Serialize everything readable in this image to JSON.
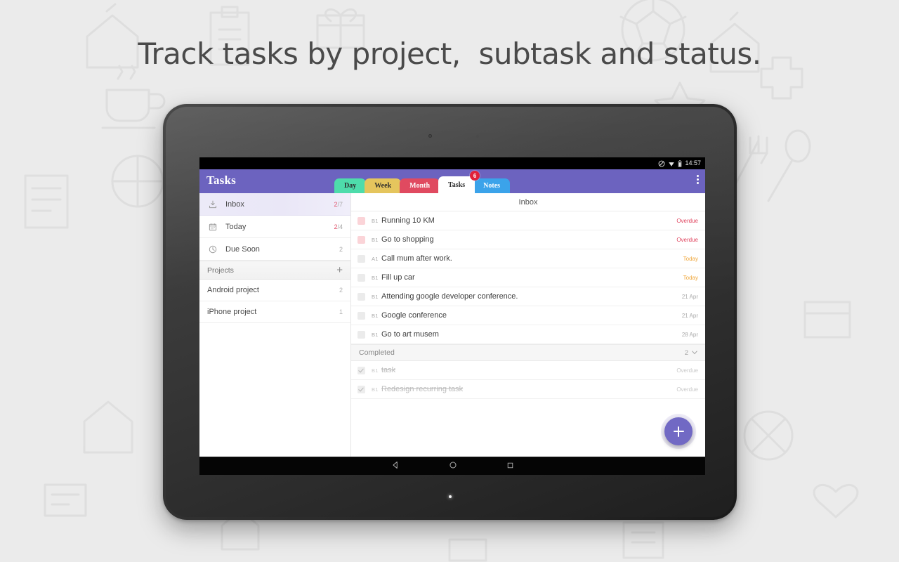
{
  "headline": "Track tasks by project,  subtask and status.",
  "statusbar": {
    "clock": "14:57",
    "icons": [
      "do-not-disturb-icon",
      "wifi-icon",
      "battery-icon"
    ]
  },
  "appbar": {
    "title": "Tasks",
    "overflow_label": "overflow-menu",
    "tabs": [
      {
        "label": "Day",
        "color": "#4edcab",
        "active": false
      },
      {
        "label": "Week",
        "color": "#e5c55d",
        "active": false
      },
      {
        "label": "Month",
        "color": "#e04a60",
        "active": false
      },
      {
        "label": "Tasks",
        "color": "#ffffff",
        "active": true
      },
      {
        "label": "Notes",
        "color": "#3ba3ea",
        "active": false
      }
    ],
    "badge": "6"
  },
  "sidebar": {
    "items": [
      {
        "label": "Inbox",
        "icon": "inbox-icon",
        "count_done": "2",
        "count_sep": "/7",
        "selected": true
      },
      {
        "label": "Today",
        "icon": "calendar-icon",
        "count_done": "2",
        "count_sep": "/4",
        "selected": false
      },
      {
        "label": "Due Soon",
        "icon": "clock-icon",
        "count_done": "",
        "count_sep": "2",
        "selected": false
      }
    ],
    "projects_header": {
      "label": "Projects",
      "add_label": "+"
    },
    "projects": [
      {
        "label": "Android project",
        "count": "2"
      },
      {
        "label": "iPhone project",
        "count": "1"
      }
    ]
  },
  "taskpane": {
    "title": "Inbox",
    "tasks": [
      {
        "name": "Running 10 KM",
        "priority": "B1",
        "due": "Overdue",
        "due_kind": "due-overdue",
        "checkbox": "overdue",
        "done": false
      },
      {
        "name": "Go to shopping",
        "priority": "B1",
        "due": "Overdue",
        "due_kind": "due-overdue",
        "checkbox": "overdue",
        "done": false
      },
      {
        "name": "Call mum after work.",
        "priority": "A1",
        "due": "Today",
        "due_kind": "due-today",
        "checkbox": "normal",
        "done": false
      },
      {
        "name": "Fill up car",
        "priority": "B1",
        "due": "Today",
        "due_kind": "due-today",
        "checkbox": "normal",
        "done": false
      },
      {
        "name": "Attending google developer conference.",
        "priority": "B1",
        "due": "21 Apr",
        "due_kind": "due-date",
        "checkbox": "normal",
        "done": false
      },
      {
        "name": "Google conference",
        "priority": "B1",
        "due": "21 Apr",
        "due_kind": "due-date",
        "checkbox": "normal",
        "done": false
      },
      {
        "name": "Go to art musem",
        "priority": "B1",
        "due": "28 Apr",
        "due_kind": "due-date",
        "checkbox": "normal",
        "done": false
      }
    ],
    "completed_header": {
      "label": "Completed",
      "count": "2",
      "chevron": "⌄"
    },
    "completed": [
      {
        "name": "task",
        "priority": "B1",
        "due": "Overdue",
        "due_kind": "due-muted",
        "checkbox": "done",
        "done": true
      },
      {
        "name": "Redesign recurring task",
        "priority": "B1",
        "due": "Overdue",
        "due_kind": "due-muted",
        "checkbox": "done",
        "done": true
      }
    ],
    "fab_label": "add-task"
  },
  "navbar": {
    "back": "back-icon",
    "home": "home-icon",
    "recents": "recents-icon"
  },
  "colors": {
    "accent_purple": "#6c63bf",
    "fab_purple": "#7169c4",
    "overdue_red": "#e0455f",
    "today_orange": "#efa73c",
    "badge_red": "#e0223a",
    "page_bg": "#ebebeb"
  }
}
